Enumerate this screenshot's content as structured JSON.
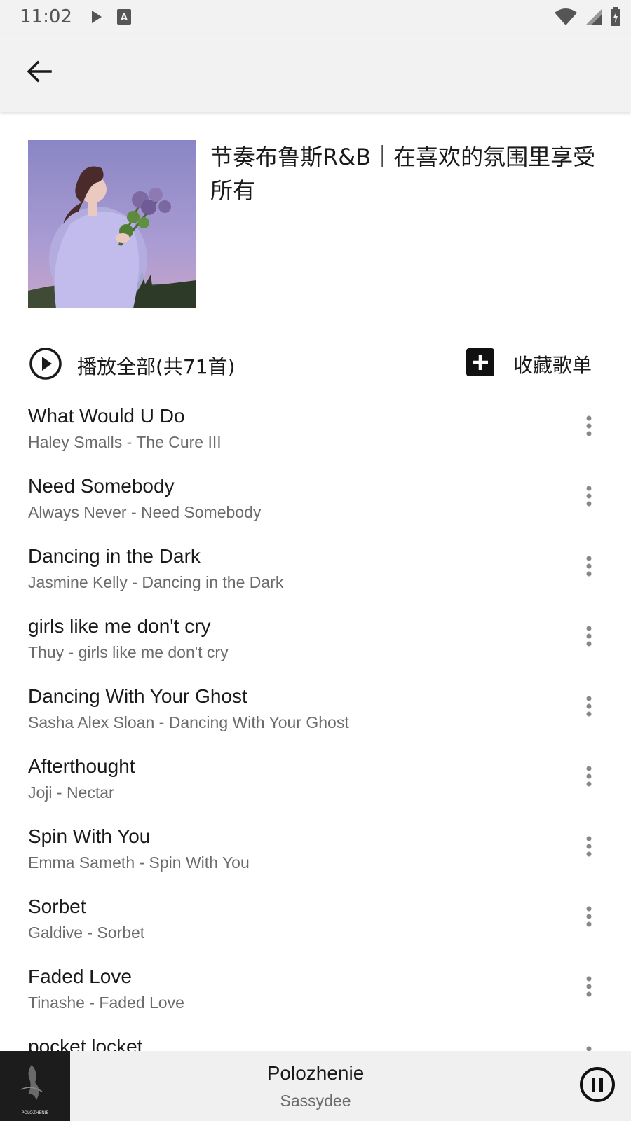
{
  "status_bar": {
    "time": "11:02",
    "left_icons": [
      "play-icon",
      "keyboard-a-icon"
    ],
    "right_icons": [
      "wifi-icon",
      "signal-icon",
      "battery-icon"
    ]
  },
  "app_bar": {
    "back_icon": "arrow-left-icon"
  },
  "playlist": {
    "title": "节奏布鲁斯R&B｜在喜欢的氛围里享受所有",
    "cover_image": "woman-with-flowers-purple-sky"
  },
  "actions": {
    "play_all_label": "播放全部(共71首)",
    "play_all_icon": "play-circle-icon",
    "collect_label": "收藏歌单",
    "collect_icon": "add-box-icon"
  },
  "songs": [
    {
      "title": "What Would U Do",
      "subtitle": "Haley Smalls - The Cure III"
    },
    {
      "title": "Need Somebody",
      "subtitle": "Always Never - Need Somebody"
    },
    {
      "title": "Dancing in the Dark",
      "subtitle": "Jasmine Kelly - Dancing in the Dark"
    },
    {
      "title": "girls like me don't cry",
      "subtitle": "Thuy - girls like me don't cry"
    },
    {
      "title": "Dancing With Your Ghost",
      "subtitle": "Sasha Alex Sloan - Dancing With Your Ghost"
    },
    {
      "title": "Afterthought",
      "subtitle": "Joji - Nectar"
    },
    {
      "title": "Spin With You",
      "subtitle": "Emma Sameth - Spin With You"
    },
    {
      "title": "Sorbet",
      "subtitle": "Galdive - Sorbet"
    },
    {
      "title": "Faded Love",
      "subtitle": "Tinashe - Faded Love"
    },
    {
      "title": "pocket locket",
      "subtitle": ""
    }
  ],
  "mini_player": {
    "title": "Polozhenie",
    "artist": "Sassydee",
    "cover_text": "POLOZHENIE",
    "pause_icon": "pause-circle-icon"
  }
}
